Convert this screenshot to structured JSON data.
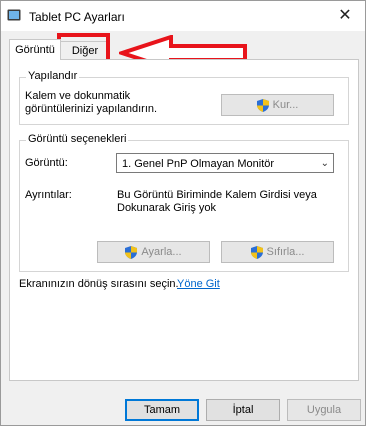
{
  "window": {
    "title": "Tablet PC Ayarları",
    "close_glyph": "✕"
  },
  "tabs": [
    {
      "label": "Görüntü"
    },
    {
      "label": "Diğer"
    }
  ],
  "configure": {
    "title": "Yapılandır",
    "line1": "Kalem ve dokunmatik",
    "line2": "görüntülerinizi yapılandırın.",
    "button": "Kur..."
  },
  "display_options": {
    "title": "Görüntü seçenekleri",
    "display_label": "Görüntü:",
    "display_value": "1. Genel PnP Olmayan Monitör",
    "details_label": "Ayrıntılar:",
    "details_line1": "Bu Görüntü Biriminde Kalem Girdisi veya",
    "details_line2": "Dokunarak Giriş yok",
    "adjust_button": "Ayarla...",
    "reset_button": "Sıfırla..."
  },
  "orientation": {
    "text": "Ekranınızın dönüş sırasını seçin.",
    "link": "Yöne Git"
  },
  "footer": {
    "ok": "Tamam",
    "cancel": "İptal",
    "apply": "Uygula"
  },
  "colors": {
    "annotation": "#e8141b",
    "accent": "#0078d7",
    "link": "#0066cc"
  }
}
